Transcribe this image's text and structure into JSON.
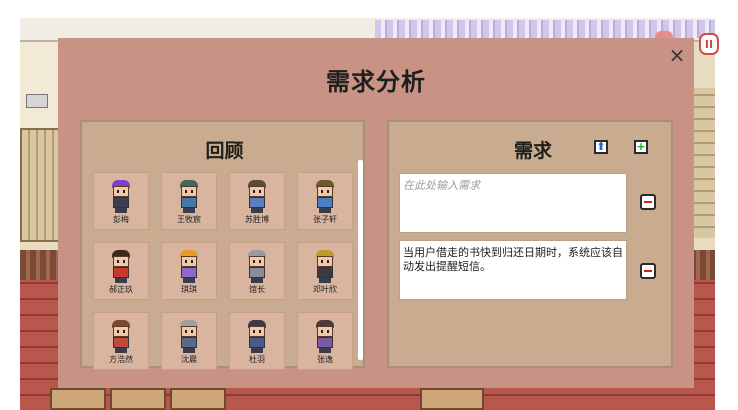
{
  "dialog": {
    "title": "需求分析",
    "close_icon": "×"
  },
  "review_panel": {
    "title": "回顾",
    "characters": [
      {
        "name": "彭梅",
        "hair": "#7b3fd0",
        "shirt": "#3c3c55"
      },
      {
        "name": "王牧宸",
        "hair": "#3f6a58",
        "shirt": "#4477aa"
      },
      {
        "name": "苏胜博",
        "hair": "#5a4a3a",
        "shirt": "#5b7fc0"
      },
      {
        "name": "张子轩",
        "hair": "#6a5a2e",
        "shirt": "#4a7fc7"
      },
      {
        "name": "郝正玖",
        "hair": "#3a2a20",
        "shirt": "#c73a2a"
      },
      {
        "name": "琪琪",
        "hair": "#e89a2a",
        "shirt": "#8a6ad0"
      },
      {
        "name": "馆长",
        "hair": "#9a9aa4",
        "shirt": "#8a8a99"
      },
      {
        "name": "邓叶欣",
        "hair": "#c09a2a",
        "shirt": "#3a3a44"
      },
      {
        "name": "方浩然",
        "hair": "#7a4a2a",
        "shirt": "#c04a3a"
      },
      {
        "name": "沈晨",
        "hair": "#a0a0a0",
        "shirt": "#5a6a8a"
      },
      {
        "name": "杜羽",
        "hair": "#3a3a4a",
        "shirt": "#4a5a8a"
      },
      {
        "name": "张逸",
        "hair": "#4a3a3a",
        "shirt": "#7a5aa0"
      }
    ]
  },
  "requirements_panel": {
    "title": "需求",
    "upload_icon": "⬆",
    "add_icon": "+",
    "input_placeholder": "在此处输入需求",
    "items": [
      "当用户借走的书快到归还日期时，系统应该自动发出提醒短信。"
    ]
  },
  "controls": {
    "pause_label": "II"
  }
}
